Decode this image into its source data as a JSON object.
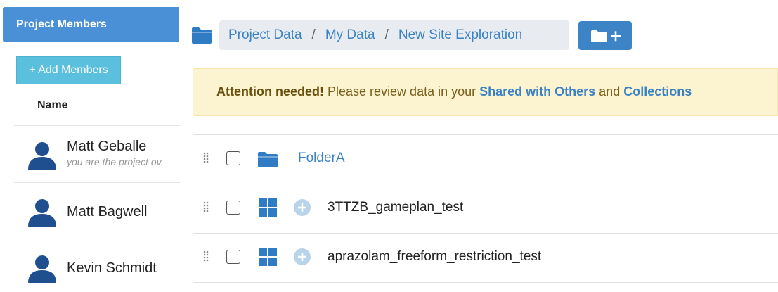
{
  "sidebar": {
    "header": "Project Members",
    "add_members_label": "+ Add Members",
    "name_column": "Name",
    "members": [
      {
        "name": "Matt Geballe",
        "subtitle": "you are the project ov"
      },
      {
        "name": "Matt Bagwell",
        "subtitle": ""
      },
      {
        "name": "Kevin Schmidt",
        "subtitle": ""
      }
    ]
  },
  "breadcrumb": {
    "items": [
      "Project Data",
      "My Data",
      "New Site Exploration"
    ],
    "separator": "/"
  },
  "alert": {
    "strong": "Attention needed!",
    "text": " Please review data in your ",
    "link1": "Shared with Others",
    "and": " and ",
    "link2": "Collections"
  },
  "rows": [
    {
      "type": "folder",
      "label": "FolderA"
    },
    {
      "type": "dataset",
      "label": "3TTZB_gameplan_test"
    },
    {
      "type": "dataset",
      "label": "aprazolam_freeform_restriction_test"
    }
  ],
  "colors": {
    "accent": "#4a90d6",
    "link": "#3b82c4",
    "alert_bg": "#fcf3d0",
    "add_button": "#5bc0de"
  }
}
